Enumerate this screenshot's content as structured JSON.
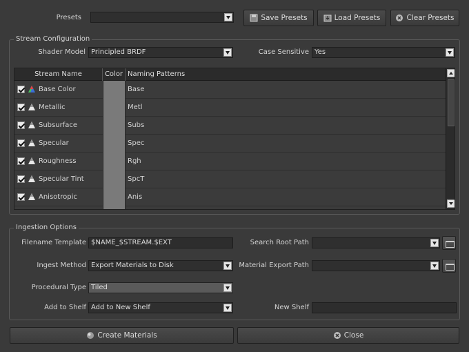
{
  "presets": {
    "label": "Presets",
    "value": "",
    "save_label": "Save Presets",
    "load_label": "Load Presets",
    "clear_label": "Clear Presets"
  },
  "stream_config": {
    "title": "Stream Configuration",
    "shader_model_label": "Shader Model",
    "shader_model_value": "Principled BRDF",
    "case_sensitive_label": "Case Sensitive",
    "case_sensitive_value": "Yes",
    "columns": [
      "Stream Name",
      "Color",
      "Naming Patterns"
    ],
    "rows": [
      {
        "name": "Base Color",
        "pattern": "Base",
        "checked": true,
        "icon": "color-stream-icon"
      },
      {
        "name": "Metallic",
        "pattern": "Metl",
        "checked": true,
        "icon": "grayscale-stream-icon"
      },
      {
        "name": "Subsurface",
        "pattern": "Subs",
        "checked": true,
        "icon": "grayscale-stream-icon"
      },
      {
        "name": "Specular",
        "pattern": "Spec",
        "checked": true,
        "icon": "grayscale-stream-icon"
      },
      {
        "name": "Roughness",
        "pattern": "Rgh",
        "checked": true,
        "icon": "grayscale-stream-icon"
      },
      {
        "name": "Specular Tint",
        "pattern": "SpcT",
        "checked": true,
        "icon": "grayscale-stream-icon"
      },
      {
        "name": "Anisotropic",
        "pattern": "Anis",
        "checked": true,
        "icon": "grayscale-stream-icon"
      }
    ]
  },
  "ingestion": {
    "title": "Ingestion Options",
    "filename_template_label": "Filename Template",
    "filename_template_value": "$NAME_$STREAM.$EXT",
    "search_root_label": "Search Root Path",
    "search_root_value": "",
    "ingest_method_label": "Ingest Method",
    "ingest_method_value": "Export Materials to Disk",
    "material_export_label": "Material Export Path",
    "material_export_value": "",
    "procedural_type_label": "Procedural Type",
    "procedural_type_value": "Tiled",
    "add_to_shelf_label": "Add to Shelf",
    "add_to_shelf_value": "Add to New Shelf",
    "new_shelf_label": "New Shelf",
    "new_shelf_value": ""
  },
  "footer": {
    "create_label": "Create Materials",
    "close_label": "Close"
  }
}
